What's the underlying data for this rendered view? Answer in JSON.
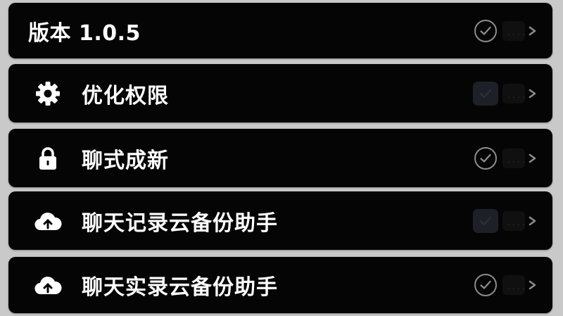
{
  "settings": {
    "rows": [
      {
        "label": "版本 1.0.5",
        "icon": null,
        "check": "ring-check"
      },
      {
        "label": "优化权限",
        "icon": "gear-icon",
        "check": "filled-box"
      },
      {
        "label": "聊式成新",
        "icon": "lock-icon",
        "check": "ring-check"
      },
      {
        "label": "聊天记录云备份助手",
        "icon": "cloud-upload-icon",
        "check": "filled-box"
      },
      {
        "label": "聊天实录云备份助手",
        "icon": "cloud-upload-icon",
        "check": "ring-check"
      }
    ]
  },
  "colors": {
    "row_bg": "#050505",
    "page_bg": "#c9c9c9",
    "text": "#ffffff",
    "check_ring": "#8d8d8d",
    "check_box": "#1d2127"
  }
}
